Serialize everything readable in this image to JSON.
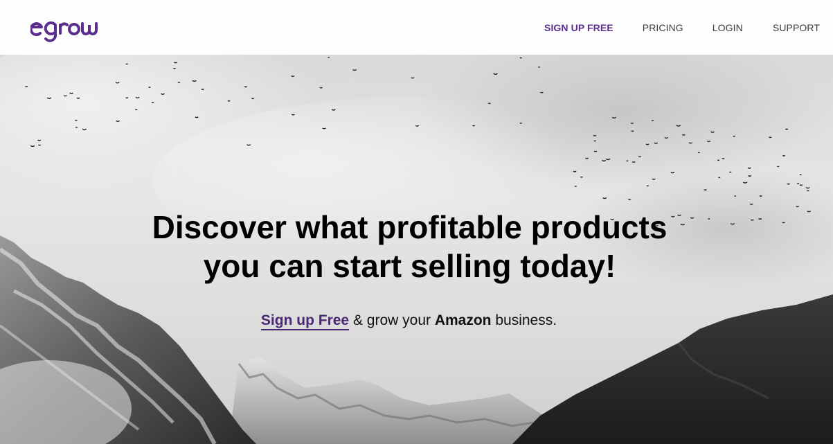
{
  "brand": {
    "logo_text": "egrow",
    "accent": "#5b2d8c"
  },
  "nav": {
    "signup": "SIGN UP FREE",
    "pricing": "PRICING",
    "login": "LOGIN",
    "support": "SUPPORT"
  },
  "hero": {
    "headline_bold_1": "Discover",
    "headline_plain_1": " what ",
    "headline_bold_2": "profitable products",
    "headline_line_2": "you can start selling today!",
    "cta_link": "Sign up Free",
    "cta_mid": " & grow your ",
    "cta_bold": "Amazon",
    "cta_end": " business."
  }
}
